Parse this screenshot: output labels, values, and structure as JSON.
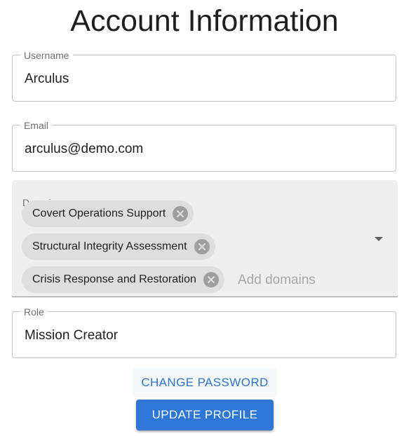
{
  "page": {
    "title": "Account Information"
  },
  "form": {
    "username": {
      "label": "Username",
      "value": "Arculus"
    },
    "email": {
      "label": "Email",
      "value": "arculus@demo.com"
    },
    "domains": {
      "label": "Domains",
      "chips": [
        "Covert Operations Support",
        "Structural Integrity Assessment",
        "Crisis Response and Restoration"
      ],
      "placeholder": "Add domains",
      "chip_delete_icon": "cancel-circle-icon",
      "dropdown_icon": "arrow-drop-down-icon"
    },
    "role": {
      "label": "Role",
      "value": "Mission Creator"
    }
  },
  "actions": {
    "change_password_label": "Change Password",
    "update_profile_label": "Update Profile"
  },
  "colors": {
    "primary": "#2f77d6",
    "primary_text": "#2f73c9",
    "filled_background": "#efefef",
    "chip_background": "#dedede",
    "outline": "#c4c4c4"
  }
}
